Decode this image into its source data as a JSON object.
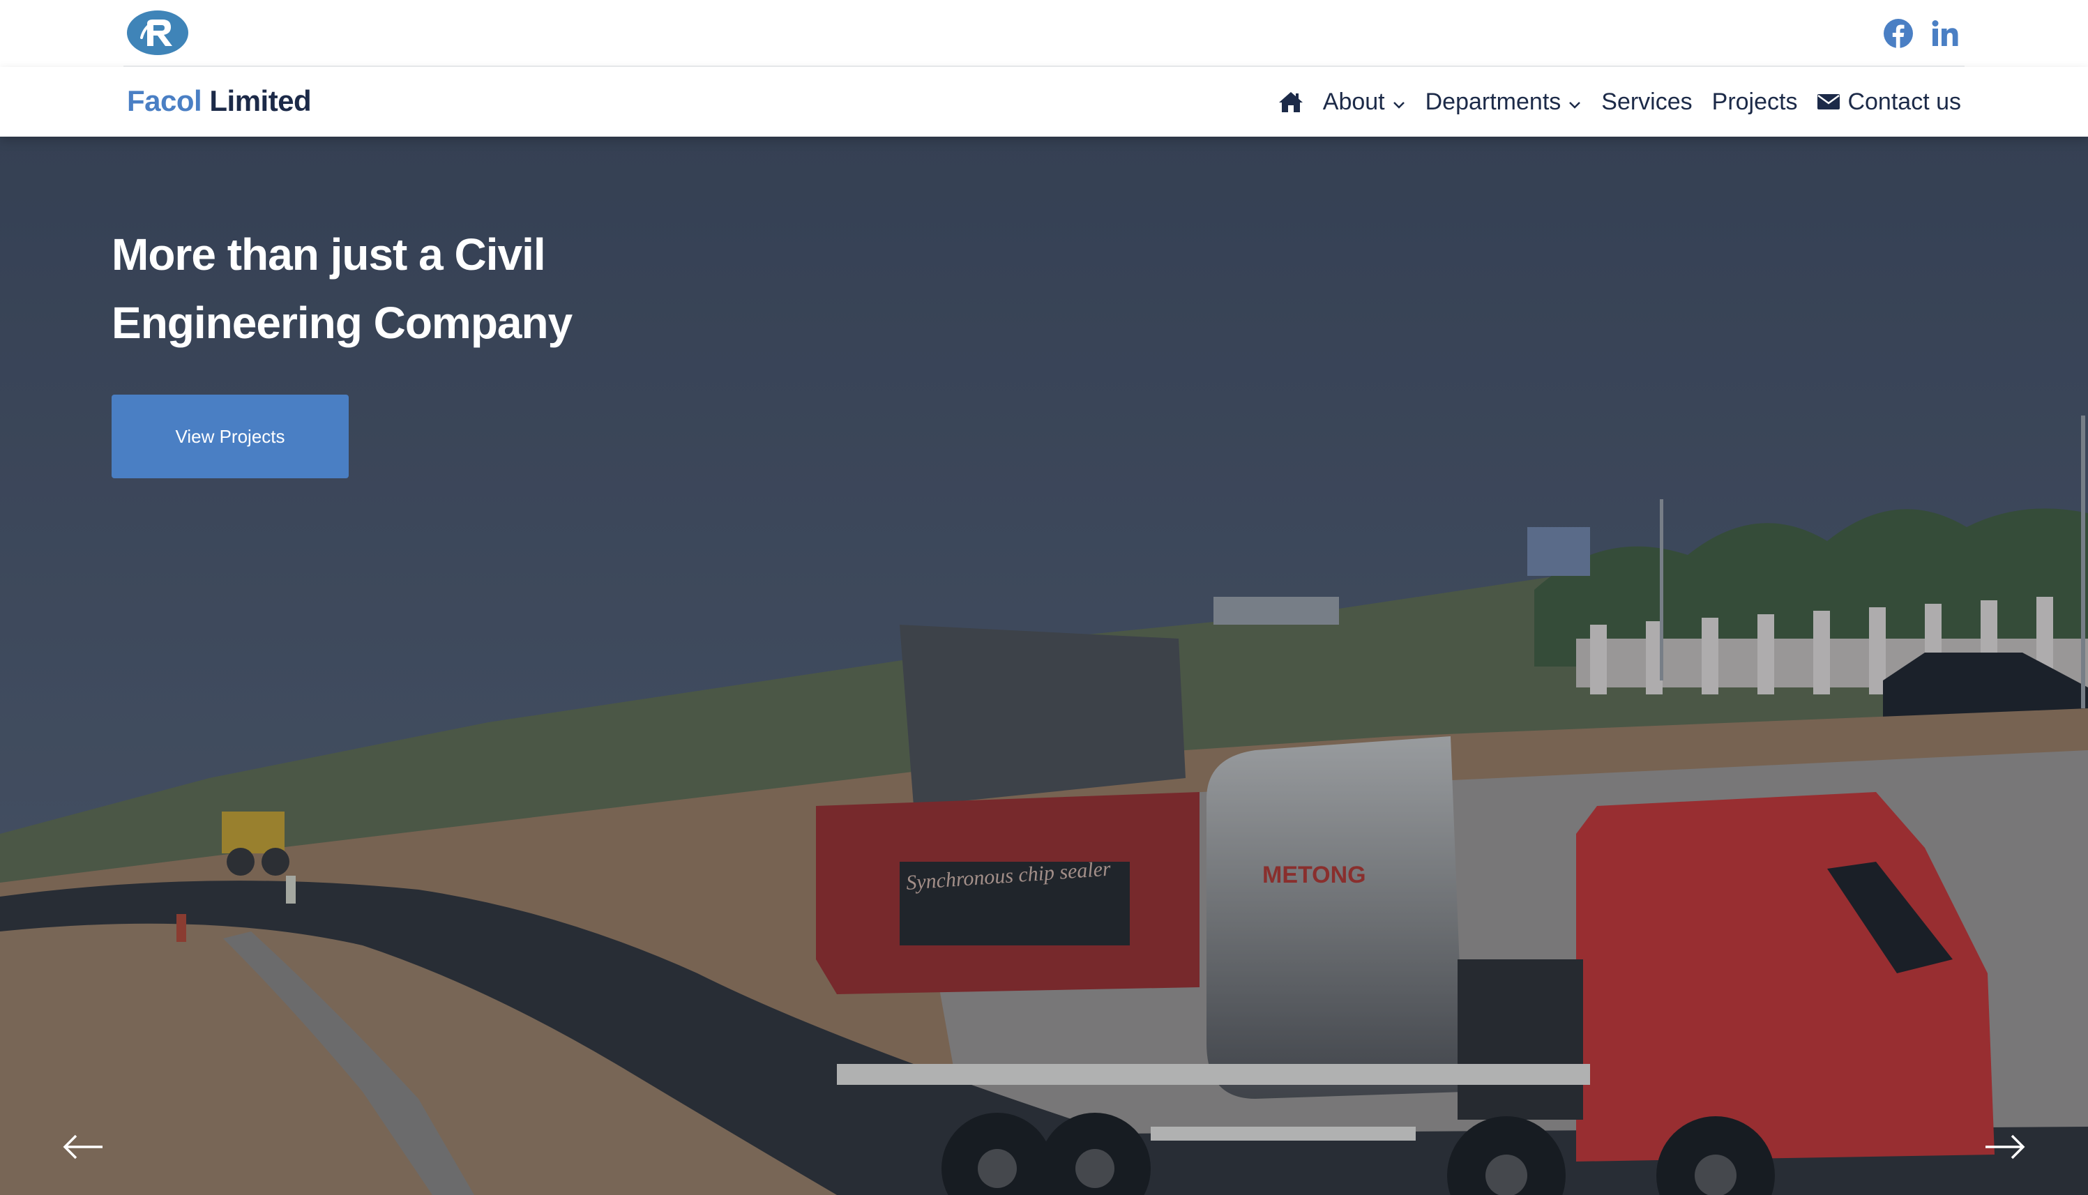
{
  "brand": {
    "part1": "Facol",
    "part2": "Limited",
    "accent_color": "#4a7fc4",
    "dark_color": "#1c2a48"
  },
  "social": [
    {
      "icon": "facebook-icon"
    },
    {
      "icon": "linkedin-icon"
    }
  ],
  "nav": {
    "home_icon": "home-icon",
    "items": [
      {
        "label": "About",
        "dropdown": true
      },
      {
        "label": "Departments",
        "dropdown": true
      },
      {
        "label": "Services",
        "dropdown": false
      },
      {
        "label": "Projects",
        "dropdown": false
      },
      {
        "label": "Contact us",
        "icon": "envelope-icon"
      }
    ]
  },
  "hero": {
    "headline_line1": "More than just a Civil",
    "headline_line2": "Engineering Company",
    "cta_label": "View Projects",
    "truck_text": "Synchronous chip sealer",
    "truck_brand": "METONG"
  },
  "carousel": {
    "prev_icon": "arrow-left-icon",
    "next_icon": "arrow-right-icon"
  }
}
